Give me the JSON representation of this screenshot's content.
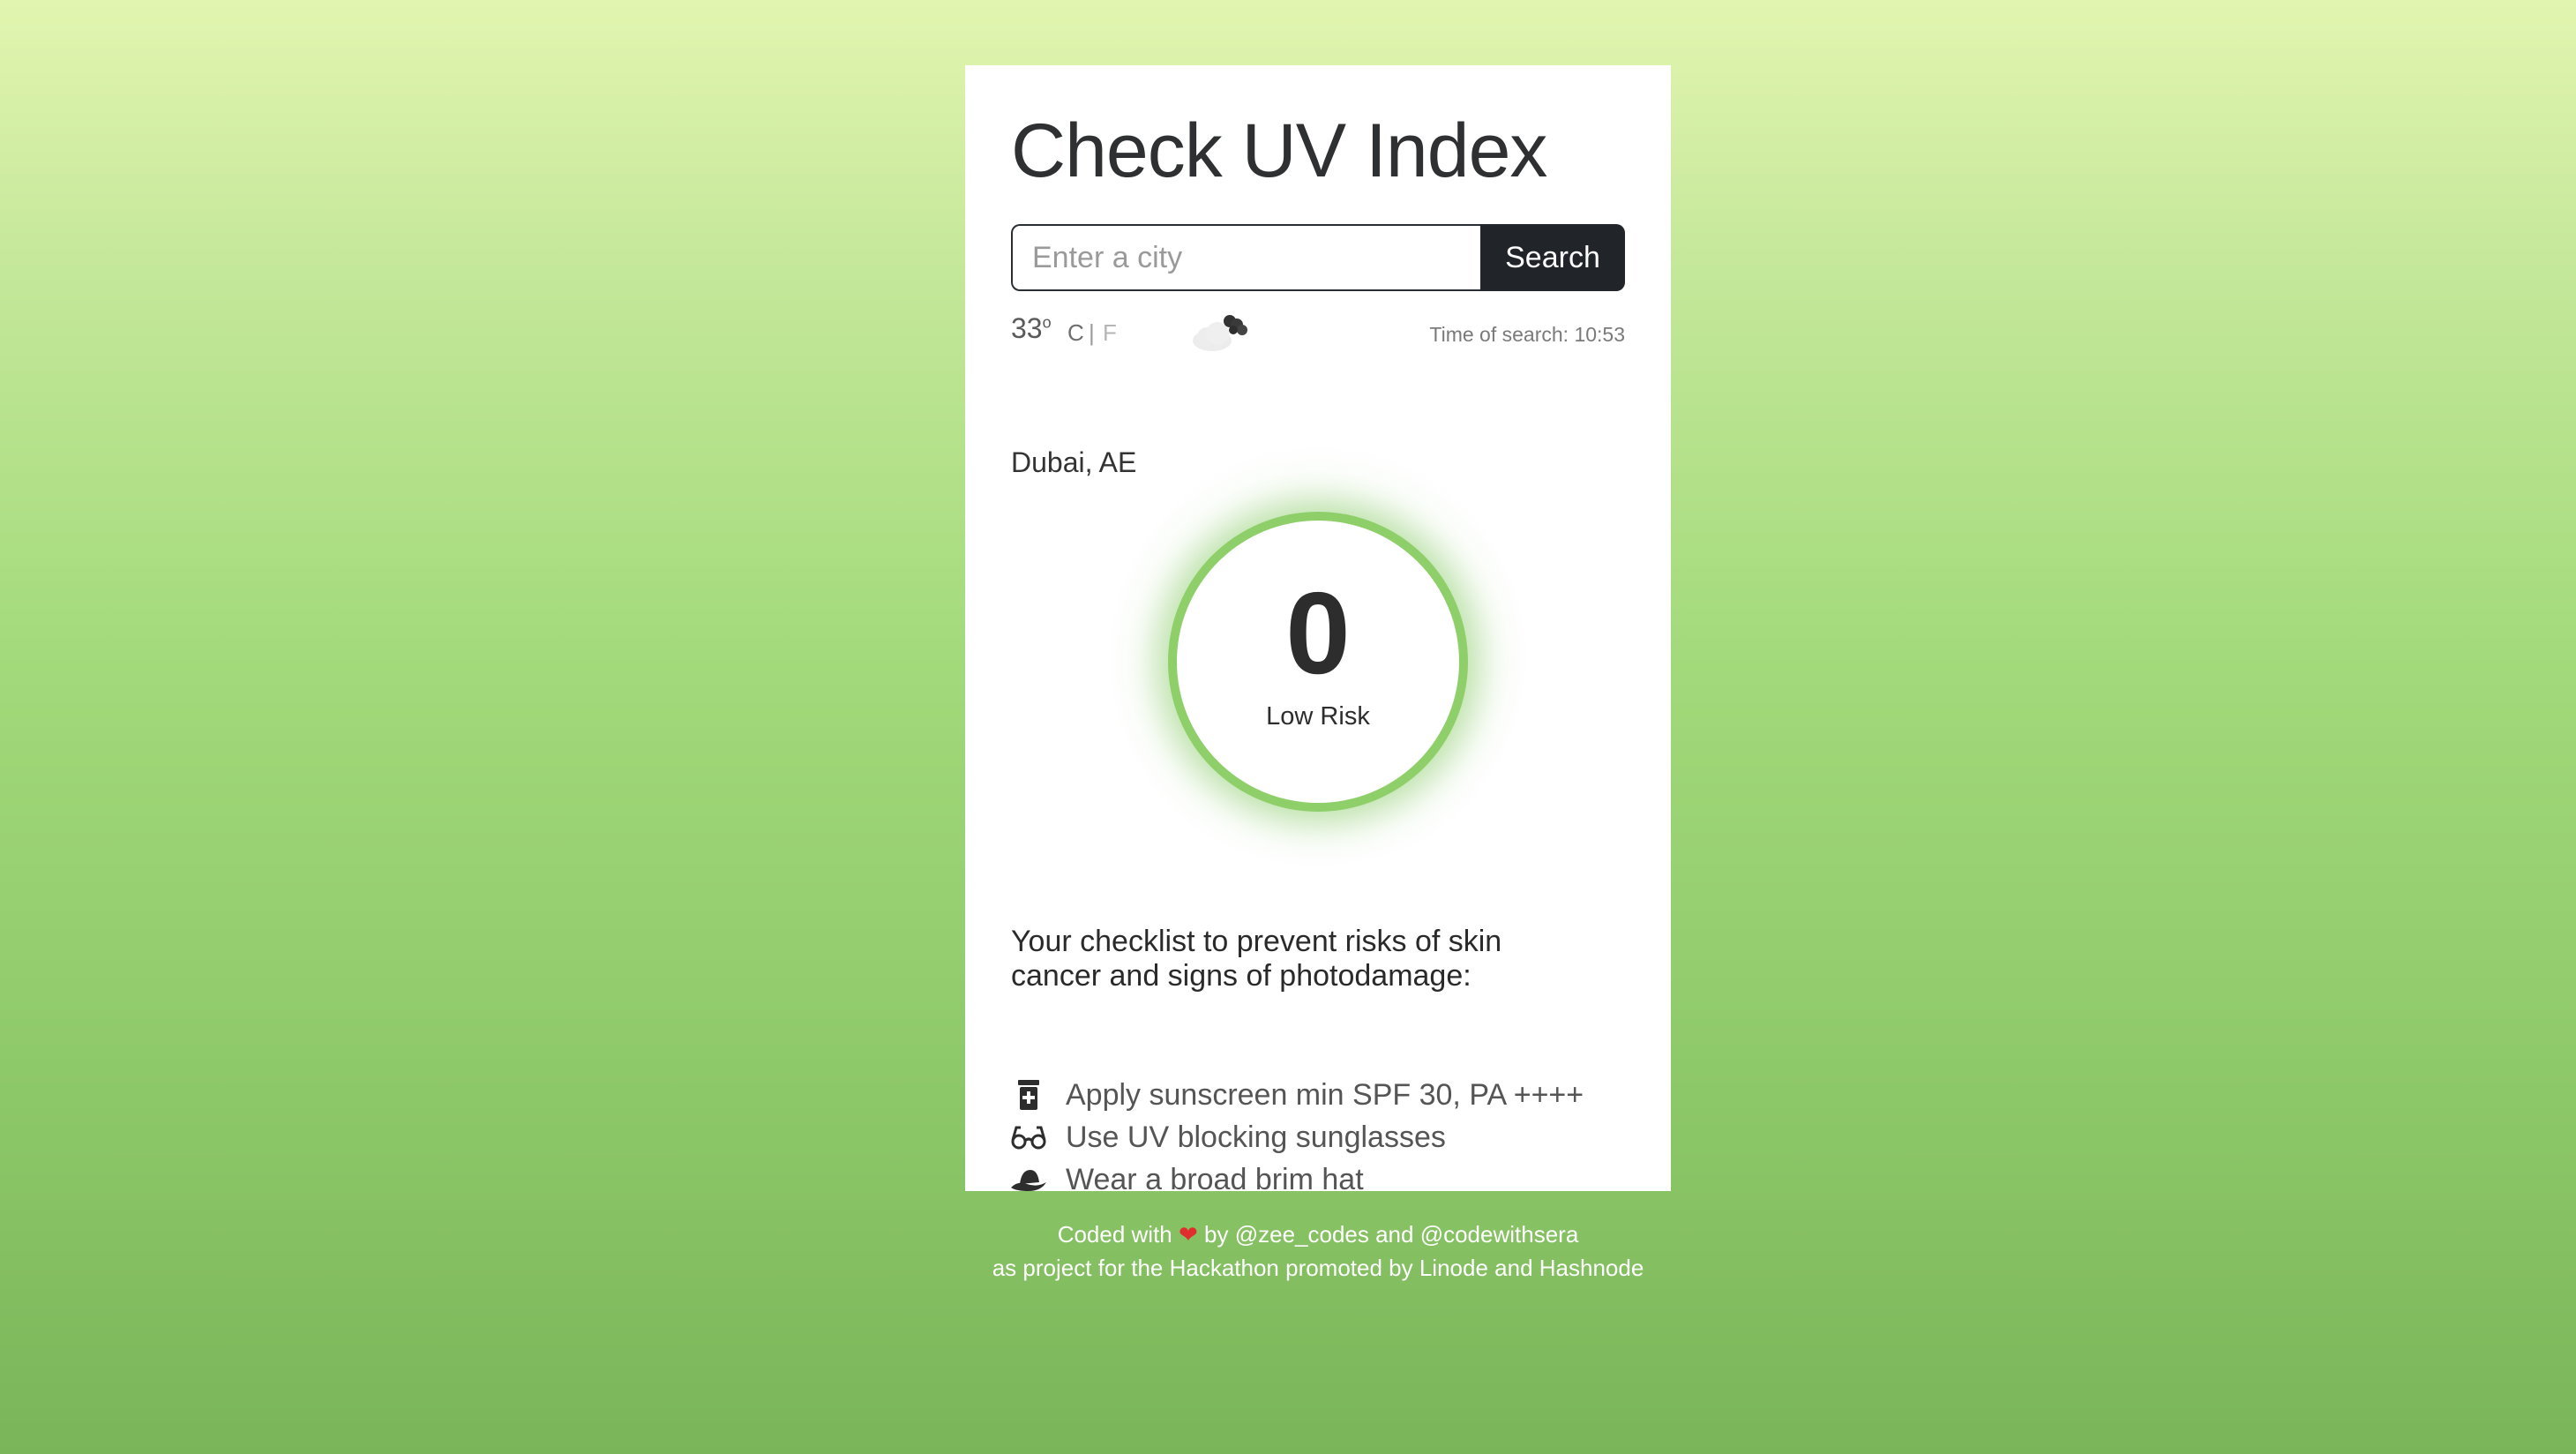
{
  "header": {
    "title": "Check UV Index"
  },
  "search": {
    "placeholder": "Enter a city",
    "value": "",
    "button_label": "Search"
  },
  "weather": {
    "temperature": "33",
    "degree_symbol": "o",
    "unit_c": "C",
    "unit_separator": "|",
    "unit_f": "F",
    "icon": "cloudy-icon",
    "time_of_search": "Time of search: 10:53"
  },
  "location": {
    "city": "Dubai, AE"
  },
  "uv": {
    "value": "0",
    "risk_label": "Low Risk",
    "accent_color": "#8fcf6a"
  },
  "checklist": {
    "title": "Your checklist to prevent risks of skin cancer and signs of photodamage:",
    "items": [
      {
        "icon": "sunscreen-icon",
        "label": "Apply sunscreen min SPF 30, PA ++++"
      },
      {
        "icon": "glasses-icon",
        "label": "Use UV blocking sunglasses"
      },
      {
        "icon": "hat-icon",
        "label": "Wear a broad brim hat"
      }
    ]
  },
  "footer": {
    "coded_with": "Coded with",
    "heart": "❤",
    "by": "by @zee_codes and @codewithsera",
    "project_line": "as project for the Hackathon promoted by Linode and Hashnode"
  }
}
